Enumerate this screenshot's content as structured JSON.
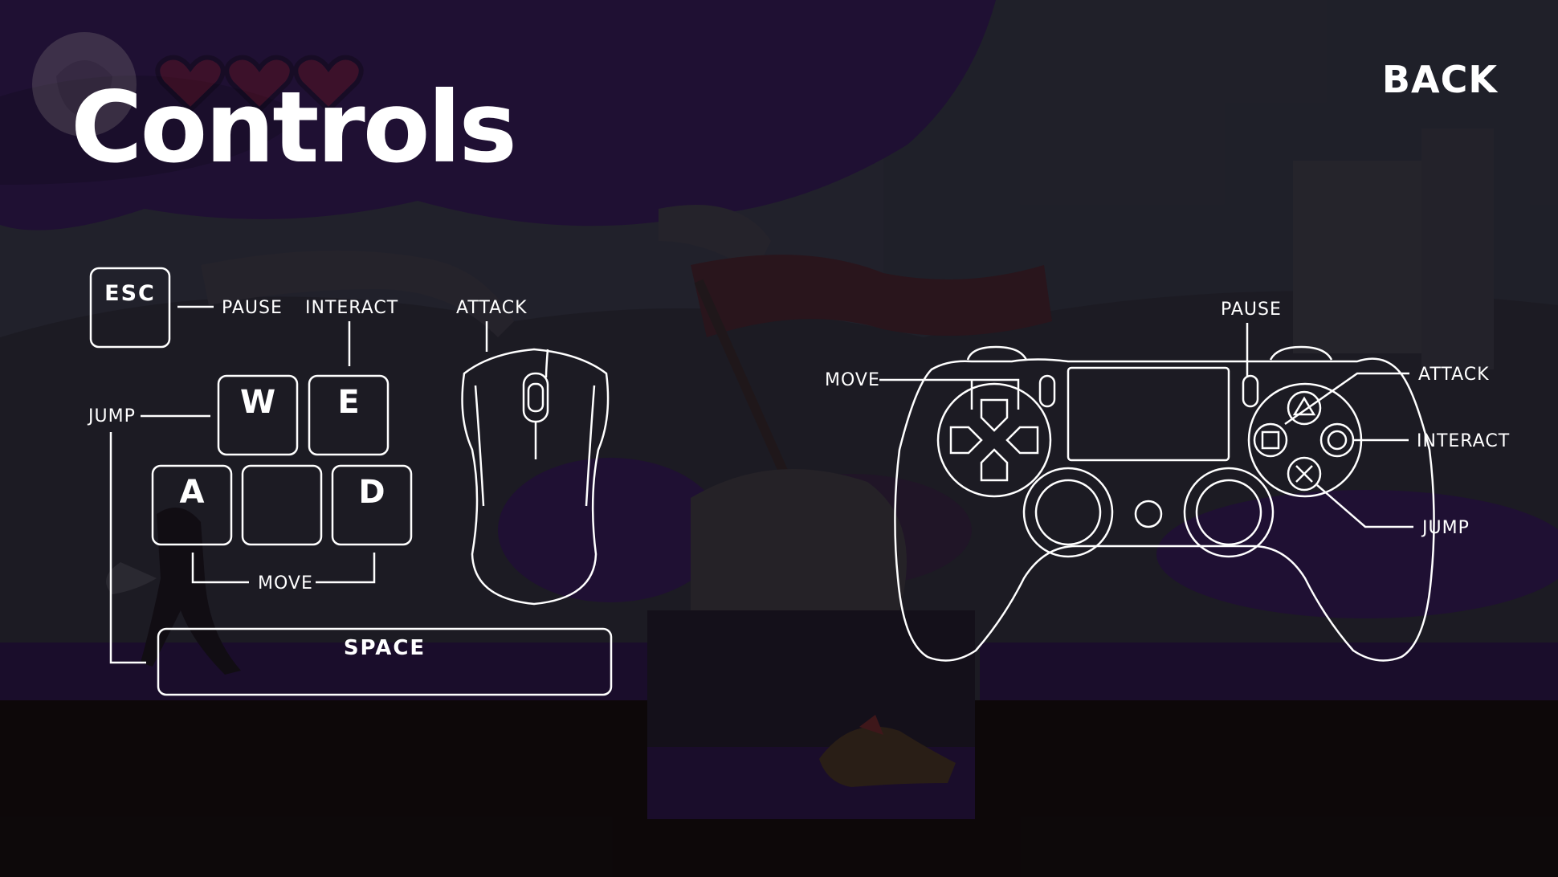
{
  "screen": {
    "title": "Controls",
    "back_label": "BACK"
  },
  "hud": {
    "hearts": 3,
    "icons": [
      "character-portrait-icon",
      "heart-icon"
    ]
  },
  "keyboard": {
    "keys": {
      "esc": "ESC",
      "w": "W",
      "e": "E",
      "a": "A",
      "s": "",
      "d": "D",
      "space": "SPACE"
    },
    "labels": {
      "pause": "PAUSE",
      "interact": "INTERACT",
      "attack": "ATTACK",
      "jump": "JUMP",
      "move": "MOVE"
    }
  },
  "controller": {
    "labels": {
      "pause": "PAUSE",
      "move": "MOVE",
      "attack": "ATTACK",
      "interact": "INTERACT",
      "jump": "JUMP"
    },
    "icons": [
      "gamepad-icon",
      "dpad-icon",
      "triangle-button-icon",
      "square-button-icon",
      "circle-button-icon",
      "cross-button-icon"
    ]
  },
  "colors": {
    "background_dark": "#0e0905",
    "foliage_purple": "#2a1545",
    "line": "#ffffff",
    "heart_red": "#5e1414"
  }
}
